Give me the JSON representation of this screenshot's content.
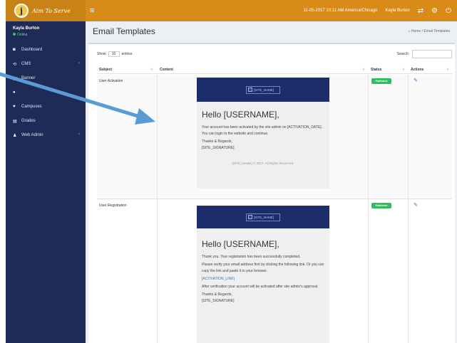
{
  "topbar": {
    "logo_letter": "j",
    "logo_text": "Aim To Serve",
    "hamburger": "≡",
    "datetime": "11-05-2017 10:11 AM",
    "timezone": "America/Chicago",
    "user": "Kayla Burton"
  },
  "sidebar": {
    "user_name": "Kayla Burton",
    "user_status": "Online",
    "items": [
      {
        "label": "Dashboard",
        "icon": "dashboard-icon",
        "glyph": "◙",
        "chevron": ""
      },
      {
        "label": "CMS",
        "icon": "cms-icon",
        "glyph": "⟲",
        "chevron": "‹"
      },
      {
        "label": "Banner",
        "icon": "image-icon",
        "glyph": "▣",
        "chevron": ""
      },
      {
        "label": "",
        "icon": "item-icon",
        "glyph": "●",
        "chevron": ""
      },
      {
        "label": "Campuses",
        "icon": "map-pin-icon",
        "glyph": "♥",
        "chevron": ""
      },
      {
        "label": "Grades",
        "icon": "grades-icon",
        "glyph": "▤",
        "chevron": ""
      },
      {
        "label": "Web Admin",
        "icon": "user-icon",
        "glyph": "♟",
        "chevron": "‹"
      }
    ]
  },
  "header": {
    "title": "Email Templates",
    "breadcrumb_home": "Home",
    "breadcrumb_current": "Email Templates"
  },
  "table": {
    "show_label": "Show",
    "entries_value": "10",
    "entries_label": "entries",
    "search_label": "Search:",
    "columns": [
      "Subject",
      "Content",
      "Status",
      "Actions"
    ],
    "rows": [
      {
        "subject": "User Activation",
        "status": "Published",
        "email": {
          "banner_img": "[SITE_NAME]",
          "greeting": "Hello [USERNAME],",
          "paragraphs": [
            "Your account has been activated by the site admin on [ACTIVATION_DATE]. You can login to the website and continue.",
            "Thanks & Regards,",
            "[SITE_SIGNATURE]"
          ],
          "footer": "[SITE_NAME] © 2017. All Rights Reserved."
        }
      },
      {
        "subject": "User Registration",
        "status": "Published",
        "email": {
          "banner_img": "[SITE_NAME]",
          "greeting": "Hello [USERNAME],",
          "paragraphs": [
            "Thank you. Your registration has been successfully completed.",
            "Please verify your email address first by clicking the following link. Or you can copy the link and paste it to your browser.",
            "[ACTIVATION_LINK]",
            "After verification your account will be activated after site admin's approval.",
            "Thanks & Regards,",
            "[SITE_SIGNATURE]"
          ]
        }
      }
    ]
  },
  "colors": {
    "topbar": "#d98b19",
    "sidebar": "#1f2b57",
    "email_banner": "#1d2c6b",
    "badge": "#2fbf5a",
    "arrow": "#5b9bd5"
  }
}
